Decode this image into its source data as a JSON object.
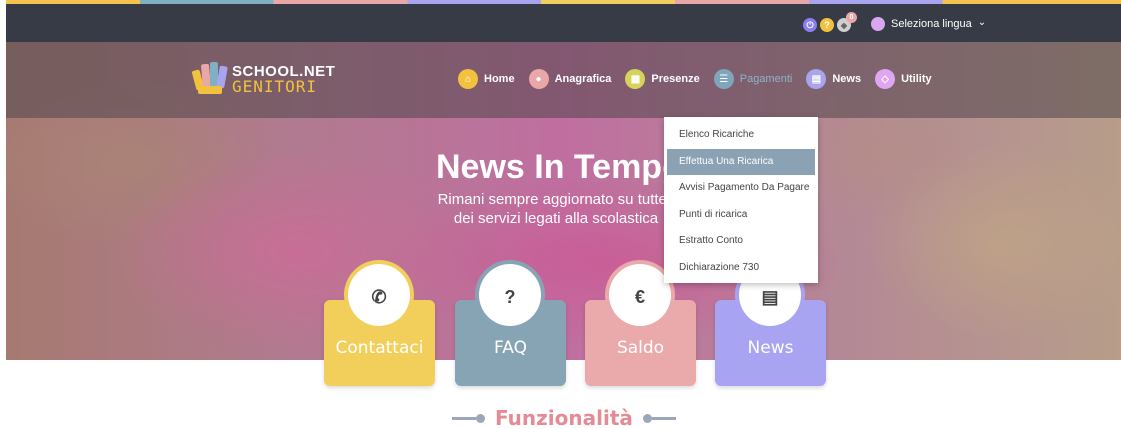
{
  "topbar": {
    "icons": [
      {
        "name": "power-icon",
        "glyph": "⏻"
      },
      {
        "name": "help-icon",
        "glyph": "?"
      },
      {
        "name": "bell-icon",
        "glyph": "🔔",
        "badge": "0"
      }
    ],
    "language_label": "Seleziona lingua",
    "language_chevron": "⌄"
  },
  "brand": {
    "line1": "SCHOOL.NET",
    "line2": "GENITORI"
  },
  "nav": {
    "items": [
      {
        "label": "Home",
        "icon": "home-icon",
        "glyph": "⌂",
        "color": "#f2c23e"
      },
      {
        "label": "Anagrafica",
        "icon": "user-icon",
        "glyph": "●",
        "color": "#e9a7a7"
      },
      {
        "label": "Presenze",
        "icon": "calendar-icon",
        "glyph": "▦",
        "color": "#d6d35a"
      },
      {
        "label": "Pagamenti",
        "icon": "list-icon",
        "glyph": "☰",
        "color": "#7fa6bd"
      },
      {
        "label": "News",
        "icon": "newspaper-icon",
        "glyph": "▤",
        "color": "#a8a4f0"
      },
      {
        "label": "Utility",
        "icon": "code-icon",
        "glyph": "◇",
        "color": "#e0a6f2"
      }
    ],
    "active": "Pagamenti"
  },
  "hero": {
    "title": "News In Tempo R",
    "subtitle_line1": "Rimani sempre aggiornato su tutte l",
    "subtitle_line2": "dei servizi legati alla scolastica"
  },
  "dropdown": {
    "items": [
      "Elenco Ricariche",
      "Effettua Una Ricarica",
      "Avvisi Pagamento Da Pagare",
      "Punti di ricarica",
      "Estratto Conto",
      "Dichiarazione 730"
    ],
    "highlighted": "Effettua Una Ricarica"
  },
  "cards": [
    {
      "label": "Contattaci",
      "icon": "phone-icon",
      "glyph": "✆",
      "color": "#f2cf5b"
    },
    {
      "label": "FAQ",
      "icon": "question-icon",
      "glyph": "?",
      "color": "#87a4b5"
    },
    {
      "label": "Saldo",
      "icon": "euro-icon",
      "glyph": "€",
      "color": "#eaa9ab"
    },
    {
      "label": "News",
      "icon": "newspaper-icon",
      "glyph": "▤",
      "color": "#a9a4f2"
    }
  ],
  "section": {
    "title": "Funzionalità"
  }
}
